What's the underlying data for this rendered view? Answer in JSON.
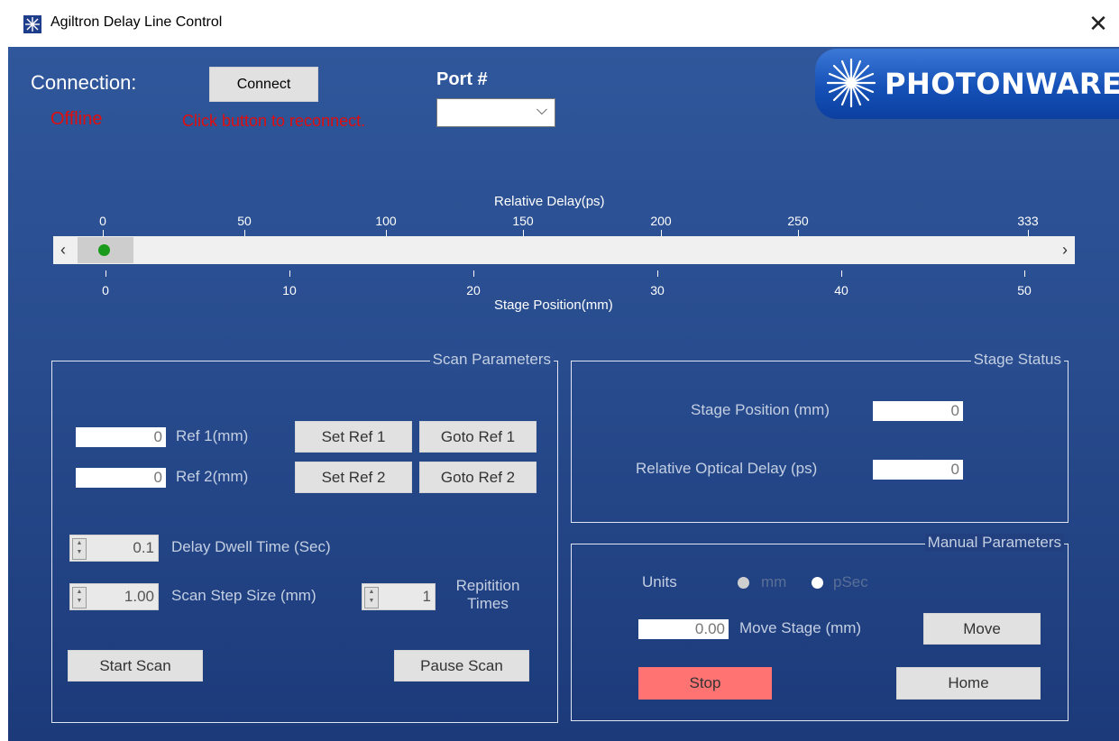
{
  "window": {
    "title": "Agiltron Delay Line Control",
    "close_glyph": "✕"
  },
  "connection": {
    "label": "Connection:",
    "connect_button": "Connect",
    "status": "Offline",
    "message": "Click button to reconnect.",
    "port_label": "Port #",
    "port_value": ""
  },
  "logo": {
    "text": "PHOTONWARES"
  },
  "slider": {
    "delay_title": "Relative Delay(ps)",
    "position_title": "Stage Position(mm)",
    "delay_ticks": [
      "0",
      "50",
      "100",
      "150",
      "200",
      "250",
      "333"
    ],
    "position_ticks": [
      "0",
      "10",
      "20",
      "30",
      "40",
      "50"
    ],
    "left_arrow": "‹",
    "right_arrow": "›",
    "position_fraction": 0.0
  },
  "scan": {
    "title": "Scan Parameters",
    "ref1_value": "0",
    "ref1_label": "Ref 1(mm)",
    "ref2_value": "0",
    "ref2_label": "Ref 2(mm)",
    "set_ref1": "Set Ref 1",
    "goto_ref1": "Goto Ref 1",
    "set_ref2": "Set Ref 2",
    "goto_ref2": "Goto Ref 2",
    "dwell_value": "0.1",
    "dwell_label": "Delay Dwell Time (Sec)",
    "step_value": "1.00",
    "step_label": "Scan Step Size (mm)",
    "rep_value": "1",
    "rep_label_1": "Repitition",
    "rep_label_2": "Times",
    "start": "Start Scan",
    "pause": "Pause Scan"
  },
  "stage_status": {
    "title": "Stage Status",
    "position_label": "Stage Position (mm)",
    "position_value": "0",
    "delay_label": "Relative Optical Delay (ps)",
    "delay_value": "0"
  },
  "manual": {
    "title": "Manual Parameters",
    "units_label": "Units",
    "unit_mm": "mm",
    "unit_psec": "pSec",
    "move_value": "0.00",
    "move_label": "Move Stage (mm)",
    "move_button": "Move",
    "stop_button": "Stop",
    "home_button": "Home"
  },
  "colors": {
    "offline_red": "#e00d0d",
    "stop_button": "#ff7373",
    "indicator_green": "#1b9b1b",
    "panel_blue": "#284c8e"
  }
}
